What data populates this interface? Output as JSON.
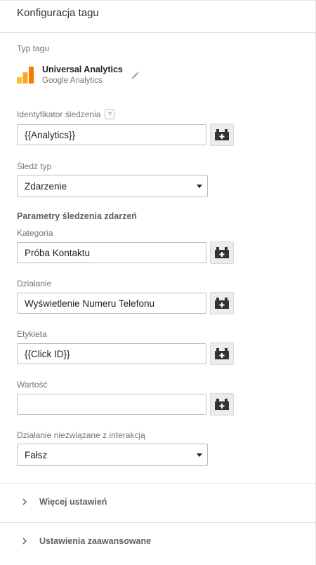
{
  "header": {
    "title": "Konfiguracja tagu"
  },
  "tag_type": {
    "label": "Typ tagu",
    "name": "Universal Analytics",
    "subtitle": "Google Analytics",
    "icon": "google-analytics-bars-icon",
    "colors": {
      "bar_light": "#fbc02d",
      "bar_dark": "#f57c00"
    }
  },
  "tracking_id": {
    "label": "Identyfikator śledzenia",
    "help": "?",
    "value": "{{Analytics}}"
  },
  "track_type": {
    "label": "Śledź typ",
    "selected": "Zdarzenie"
  },
  "event_params": {
    "title": "Parametry śledzenia zdarzeń"
  },
  "category": {
    "label": "Kategoria",
    "value": "Próba Kontaktu"
  },
  "action": {
    "label": "Działanie",
    "value": "Wyświetlenie Numeru Telefonu"
  },
  "event_label": {
    "label": "Etykieta",
    "value": "{{Click ID}}"
  },
  "value_field": {
    "label": "Wartość",
    "value": ""
  },
  "non_interaction": {
    "label": "Działanie niezwiązane z interakcją",
    "selected": "Fałsz"
  },
  "expanders": [
    {
      "label": "Więcej ustawień"
    },
    {
      "label": "Ustawienia zaawansowane"
    }
  ]
}
